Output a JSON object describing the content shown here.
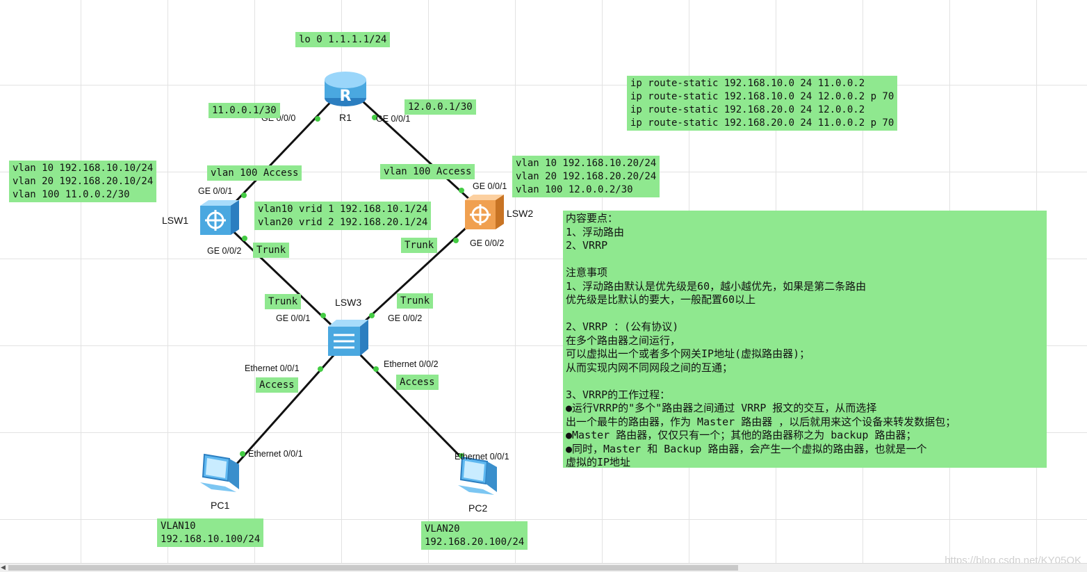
{
  "router": {
    "name": "R1",
    "loopback": "lo 0 1.1.1.1/24"
  },
  "switches": {
    "lsw1": "LSW1",
    "lsw2": "LSW2",
    "lsw3": "LSW3"
  },
  "pcs": {
    "pc1": "PC1",
    "pc2": "PC2"
  },
  "ports": {
    "r1_g000": "GE 0/0/0",
    "r1_g001": "GE 0/0/1",
    "lsw1_g001": "GE 0/0/1",
    "lsw1_g002": "GE 0/0/2",
    "lsw2_g001": "GE 0/0/1",
    "lsw2_g002": "GE 0/0/2",
    "lsw3_g001": "GE 0/0/1",
    "lsw3_g002": "GE 0/0/2",
    "lsw3_e001": "Ethernet 0/0/1",
    "lsw3_e002": "Ethernet 0/0/2",
    "pc1_e001": "Ethernet 0/0/1",
    "pc2_e001": "Ethernet 0/0/1"
  },
  "notes": {
    "r1_link1": "11.0.0.1/30",
    "r1_link2": "12.0.0.1/30",
    "static_routes": [
      "ip route-static 192.168.10.0 24 11.0.0.2",
      "ip route-static 192.168.10.0 24 12.0.0.2 p 70",
      "ip route-static 192.168.20.0 24 12.0.0.2",
      "ip route-static 192.168.20.0 24 11.0.0.2 p 70"
    ],
    "lsw1_vlans": [
      "vlan 10 192.168.10.10/24",
      "vlan 20 192.168.20.10/24",
      "vlan 100 11.0.0.2/30"
    ],
    "lsw2_vlans": [
      "vlan 10 192.168.10.20/24",
      "vlan 20 192.168.20.20/24",
      "vlan 100 12.0.0.2/30"
    ],
    "vlan100_access_left": "vlan 100 Access",
    "vlan100_access_right": "vlan 100 Access",
    "vrrp": [
      "vlan10 vrid 1 192.168.10.1/24",
      "vlan20 vrid 2 192.168.20.1/24"
    ],
    "trunk_lsw1": "Trunk",
    "trunk_lsw2": "Trunk",
    "trunk_lsw3_left": "Trunk",
    "trunk_lsw3_right": "Trunk",
    "access_left": "Access",
    "access_right": "Access",
    "pc1_info": [
      "VLAN10",
      "192.168.10.100/24"
    ],
    "pc2_info": [
      "VLAN20",
      "192.168.20.100/24"
    ],
    "content_points": "内容要点：\n1、浮动路由\n2、VRRP\n\n注意事项\n1、浮动路由默认是优先级是60，越小越优先，如果是第二条路由\n优先级是比默认的要大，一般配置60以上\n\n2、VRRP ：(公有协议)\n在多个路由器之间运行，\n可以虚拟出一个或者多个网关IP地址(虚拟路由器)；\n从而实现内网不同网段之间的互通；\n\n3、VRRP的工作过程：\n●运行VRRP的\"多个\"路由器之间通过 VRRP 报文的交互，从而选择\n出一个最牛的路由器，作为 Master 路由器 ，以后就用来这个设备来转发数据包；\n●Master 路由器，仅仅只有一个；其他的路由器称之为 backup 路由器；\n●同时，Master 和 Backup 路由器，会产生一个虚拟的路由器，也就是一个\n虚拟的IP地址"
  },
  "watermark": "https://blog.csdn.net/KY05QK",
  "colors": {
    "note_bg": "#8fe88f",
    "link": "#111111",
    "port_dot": "#44cc44",
    "router": "#4aa8e0",
    "lsw1": "#4aa8e0",
    "lsw2": "#f0a050",
    "lsw3": "#4aa8e0",
    "pc": "#5fb8f0"
  }
}
